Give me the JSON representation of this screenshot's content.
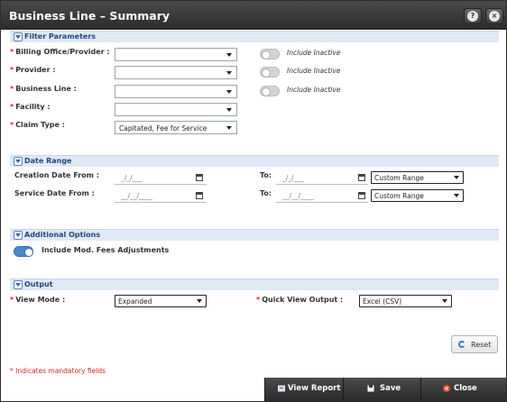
{
  "window": {
    "title": "Business Line – Summary"
  },
  "sections": {
    "filter": "Filter Parameters",
    "date": "Date Range",
    "additional": "Additional Options",
    "output": "Output"
  },
  "filter": {
    "billing_office_label": "Billing Office/Provider :",
    "provider_label": "Provider :",
    "business_line_label": "Business Line :",
    "facility_label": "Facility :",
    "claim_type_label": "Claim Type :",
    "claim_type_value": "Capitated, Fee for Service",
    "include_inactive": "Include Inactive"
  },
  "date_range": {
    "creation_label": "Creation Date From :",
    "service_label": "Service Date From :",
    "to_label": "To:",
    "creation_from": "_/_/___",
    "creation_to": "_/_/___",
    "service_from": "__/__/____",
    "service_to": "__/__/____",
    "range_option": "Custom Range"
  },
  "additional": {
    "mod_fees_label": "Include Mod. Fees Adjustments",
    "mod_fees_on": true
  },
  "output": {
    "view_mode_label": "View Mode :",
    "view_mode_value": "Expanded",
    "quick_view_label": "Quick View Output :",
    "quick_view_value": "Excel (CSV)"
  },
  "buttons": {
    "reset": "Reset",
    "view_report": "View Report",
    "save": "Save",
    "close": "Close"
  },
  "mandatory_note": "* Indicates mandatory fields",
  "colors": {
    "accent": "#3f79c7",
    "required": "#dd2222",
    "close_icon": "#e04a2c"
  }
}
